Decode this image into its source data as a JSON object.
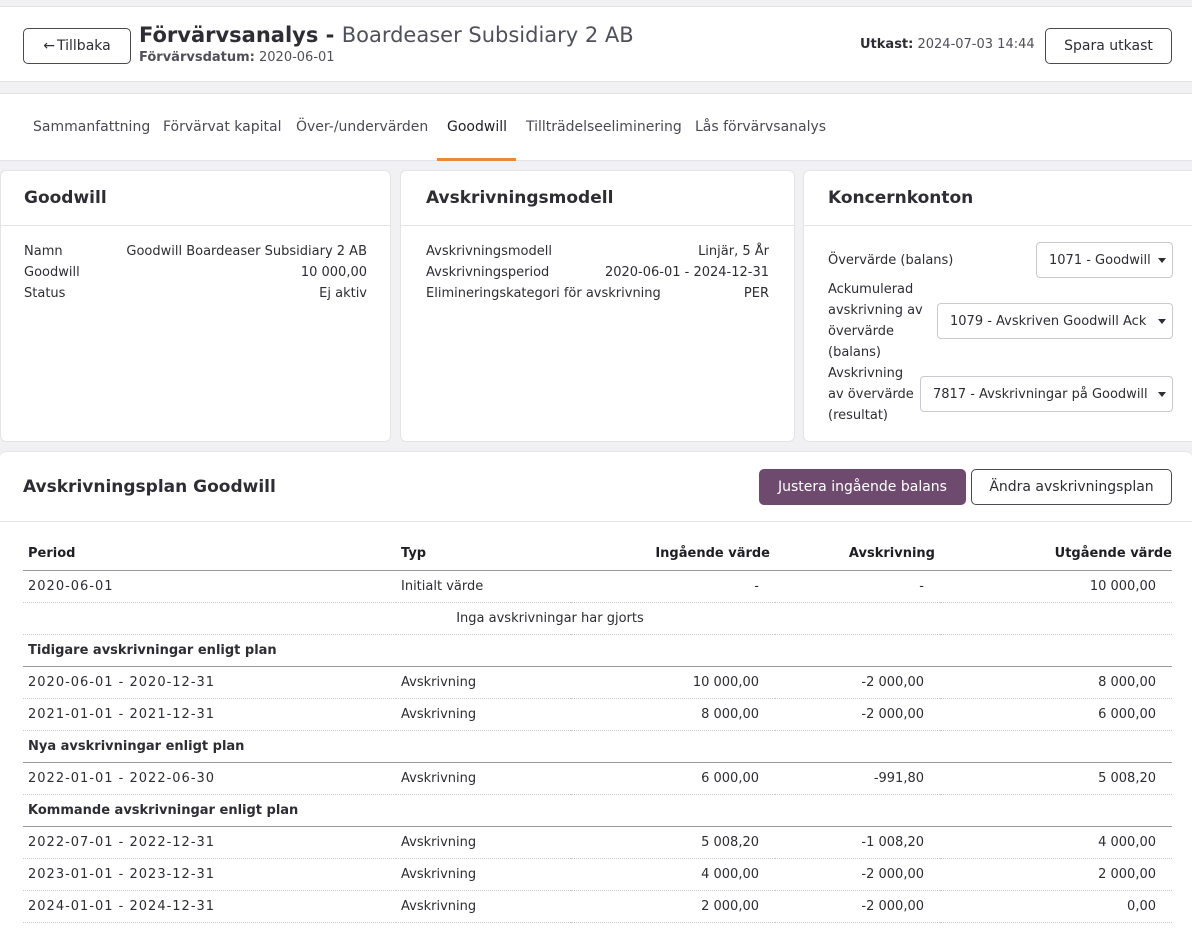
{
  "header": {
    "back_label": "Tillbaka",
    "title_prefix": "Förvärvsanalys -",
    "title_company": "Boardeaser Subsidiary 2 AB",
    "acq_date_label": "Förvärvsdatum:",
    "acq_date_value": "2020-06-01",
    "draft_label": "Utkast:",
    "draft_value": "2024-07-03 14:44",
    "save_label": "Spara utkast"
  },
  "tabs": [
    {
      "label": "Sammanfattning"
    },
    {
      "label": "Förvärvat kapital"
    },
    {
      "label": "Över-/undervärden"
    },
    {
      "label": "Goodwill",
      "active": true
    },
    {
      "label": "Tillträdelseeliminering"
    },
    {
      "label": "Lås förvärvsanalys"
    }
  ],
  "goodwill": {
    "title": "Goodwill",
    "rows": [
      {
        "label": "Namn",
        "value": "Goodwill Boardeaser Subsidiary 2 AB"
      },
      {
        "label": "Goodwill",
        "value": "10 000,00"
      },
      {
        "label": "Status",
        "value": "Ej aktiv"
      }
    ]
  },
  "model": {
    "title": "Avskrivningsmodell",
    "rows": [
      {
        "label": "Avskrivningsmodell",
        "value": "Linjär, 5 År"
      },
      {
        "label": "Avskrivningsperiod",
        "value": "2020-06-01 - 2024-12-31"
      },
      {
        "label": "Elimineringskategori för avskrivning",
        "value": "PER"
      }
    ]
  },
  "accounts": {
    "title": "Koncernkonton",
    "items": [
      {
        "label_lines": [
          "Övervärde (balans)"
        ],
        "selected": "1071 - Goodwill"
      },
      {
        "label_lines": [
          "Ackumulerad",
          "avskrivning av",
          "övervärde",
          "(balans)"
        ],
        "selected": "1079 - Avskriven Goodwill Ack"
      },
      {
        "label_lines": [
          "Avskrivning",
          "av övervärde",
          "(resultat)"
        ],
        "selected": "7817 - Avskrivningar på Goodwill"
      }
    ]
  },
  "schedule": {
    "title": "Avskrivningsplan Goodwill",
    "adjust_label": "Justera ingående balans",
    "change_label": "Ändra avskrivningsplan",
    "columns": [
      "Period",
      "Typ",
      "Ingående värde",
      "Avskrivning",
      "Utgående värde"
    ],
    "rows": [
      {
        "kind": "data",
        "period": "2020-06-01",
        "type": "Initialt värde",
        "opening": "-",
        "depreciation": "-",
        "closing": "10 000,00"
      },
      {
        "kind": "note",
        "text": "Inga avskrivningar har gjorts"
      },
      {
        "kind": "group",
        "text": "Tidigare avskrivningar enligt plan"
      },
      {
        "kind": "data",
        "period": "2020-06-01 - 2020-12-31",
        "type": "Avskrivning",
        "opening": "10 000,00",
        "depreciation": "-2 000,00",
        "closing": "8 000,00"
      },
      {
        "kind": "data",
        "period": "2021-01-01 - 2021-12-31",
        "type": "Avskrivning",
        "opening": "8 000,00",
        "depreciation": "-2 000,00",
        "closing": "6 000,00"
      },
      {
        "kind": "group",
        "text": "Nya avskrivningar enligt plan"
      },
      {
        "kind": "data",
        "period": "2022-01-01 - 2022-06-30",
        "type": "Avskrivning",
        "opening": "6 000,00",
        "depreciation": "-991,80",
        "closing": "5 008,20"
      },
      {
        "kind": "group",
        "text": "Kommande avskrivningar enligt plan"
      },
      {
        "kind": "data",
        "period": "2022-07-01 - 2022-12-31",
        "type": "Avskrivning",
        "opening": "5 008,20",
        "depreciation": "-1 008,20",
        "closing": "4 000,00"
      },
      {
        "kind": "data",
        "period": "2023-01-01 - 2023-12-31",
        "type": "Avskrivning",
        "opening": "4 000,00",
        "depreciation": "-2 000,00",
        "closing": "2 000,00"
      },
      {
        "kind": "data",
        "period": "2024-01-01 - 2024-12-31",
        "type": "Avskrivning",
        "opening": "2 000,00",
        "depreciation": "-2 000,00",
        "closing": "0,00"
      }
    ]
  },
  "colors": {
    "accent": "#e88a3c",
    "primary_button": "#6e4b6e"
  }
}
